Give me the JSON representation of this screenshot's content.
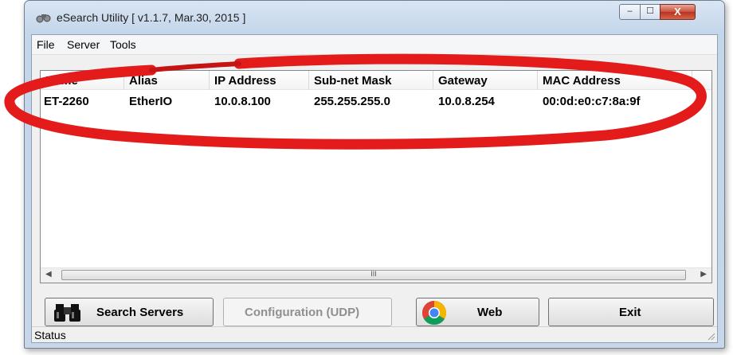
{
  "window": {
    "title": "eSearch Utility [ v1.1.7, Mar.30, 2015 ]",
    "controls": {
      "minimize": "–",
      "maximize": "☐",
      "close": "X"
    }
  },
  "menu": [
    "File",
    "Server",
    "Tools"
  ],
  "table": {
    "columns": [
      "Name",
      "Alias",
      "IP Address",
      "Sub-net Mask",
      "Gateway",
      "MAC Address"
    ],
    "rows": [
      [
        "ET-2260",
        "EtherIO",
        "10.0.8.100",
        "255.255.255.0",
        "10.0.8.254",
        "00:0d:e0:c7:8a:9f"
      ]
    ]
  },
  "scrollbar": {
    "thumb_grip": "III",
    "left_arrow": "◀",
    "right_arrow": "▶"
  },
  "buttons": {
    "search": "Search Servers",
    "configuration": "Configuration (UDP)",
    "web": "Web",
    "exit": "Exit"
  },
  "status": {
    "text": "Status"
  },
  "icons": {
    "app": "binoculars-icon",
    "search": "binoculars-icon",
    "web": "chrome-browser-icon"
  },
  "colors": {
    "highlight": "#e31b1b",
    "titlebar": "#c4d6ea",
    "close_button": "#c9503c"
  }
}
